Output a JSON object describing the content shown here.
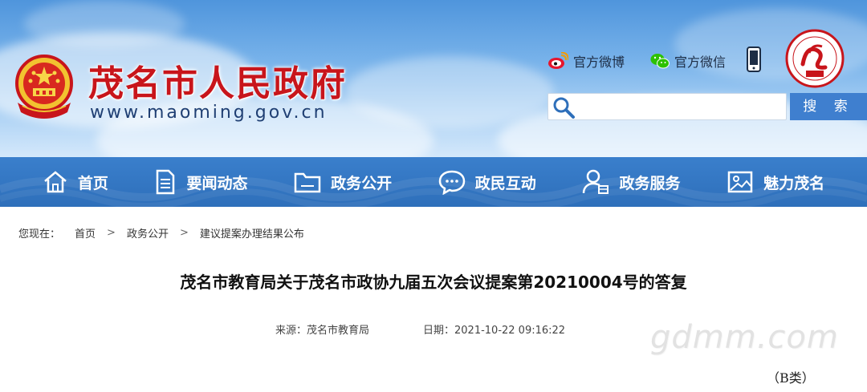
{
  "header": {
    "site_title": "茂名市人民政府",
    "site_url": "www.maoming.gov.cn",
    "social": {
      "weibo_label": "官方微博",
      "wechat_label": "官方微信"
    },
    "search": {
      "placeholder": "",
      "button_label": "搜 索"
    },
    "icons": [
      "national-emblem",
      "weibo-icon",
      "wechat-icon",
      "phone-icon",
      "city-logo",
      "search-icon"
    ]
  },
  "nav": {
    "items": [
      {
        "label": "首页",
        "icon": "home-icon"
      },
      {
        "label": "要闻动态",
        "icon": "document-icon"
      },
      {
        "label": "政务公开",
        "icon": "folder-icon"
      },
      {
        "label": "政民互动",
        "icon": "chat-icon"
      },
      {
        "label": "政务服务",
        "icon": "user-service-icon"
      },
      {
        "label": "魅力茂名",
        "icon": "picture-icon"
      }
    ]
  },
  "breadcrumb": {
    "prefix": "您现在：",
    "items": [
      "首页",
      "政务公开",
      "建议提案办理结果公布"
    ],
    "separator": ">"
  },
  "article": {
    "title": "茂名市教育局关于茂名市政协九届五次会议提案第20210004号的答复",
    "source": "来源：茂名市教育局",
    "date": "日期：2021-10-22 09:16:22",
    "category": "（B类）"
  },
  "watermark": "gdmm.com",
  "colors": {
    "title_red": "#c8151b",
    "nav_blue": "#2e6fba",
    "search_button_blue": "#3f7fcf"
  }
}
